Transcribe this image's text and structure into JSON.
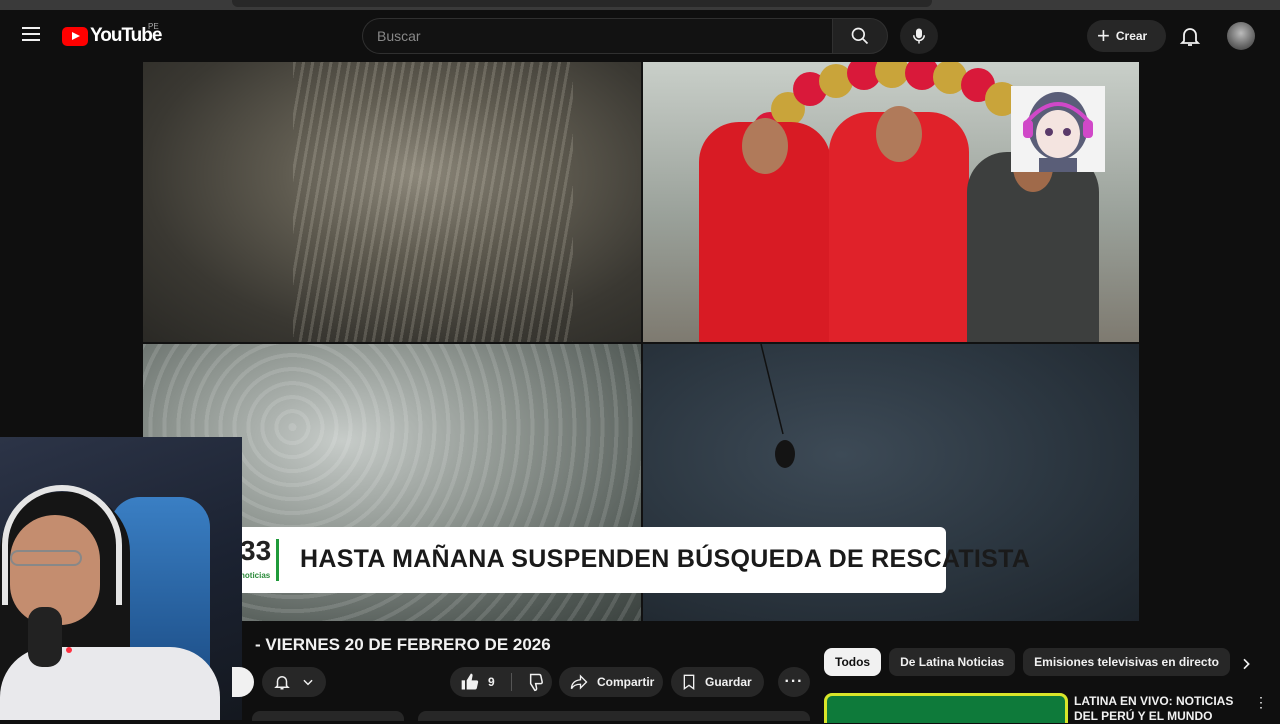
{
  "header": {
    "logo_text": "YouTube",
    "region": "PE",
    "search_placeholder": "Buscar",
    "create_label": "Crear"
  },
  "video": {
    "headline_number": "33",
    "headline_brand": "noticias",
    "headline_text": "HASTA MAÑANA SUSPENDEN BÚSQUEDA DE RESCATISTA"
  },
  "below": {
    "title": "- VIERNES 20 DE FEBRERO DE 2026",
    "like_count": "9",
    "share_label": "Compartir",
    "save_label": "Guardar",
    "more_label": "···"
  },
  "sidebar": {
    "chips": [
      {
        "label": "Todos",
        "active": true
      },
      {
        "label": "De Latina Noticias",
        "active": false
      },
      {
        "label": "Emisiones televisivas en directo",
        "active": false
      }
    ],
    "rec_title": "LATINA EN VIVO: NOTICIAS DEL PERÚ Y EL MUNDO",
    "rec_more": "⋮"
  },
  "colors": {
    "brand_red": "#ff0000",
    "background": "#0f0f0f",
    "button_bg": "#272727",
    "headline_accent": "#1f9a3a"
  }
}
